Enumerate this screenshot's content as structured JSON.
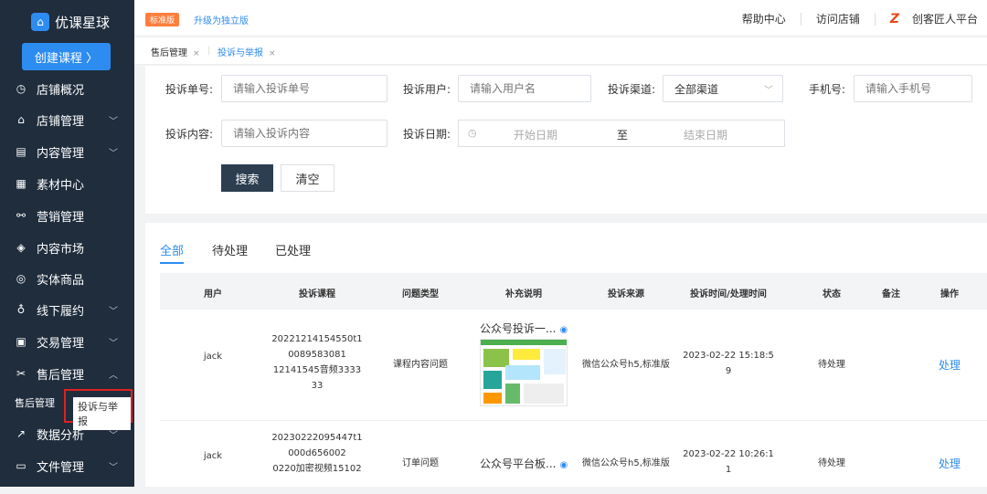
{
  "sidebar": {
    "logo_text": "优课星球",
    "create_button": "创建课程 〉",
    "items": [
      {
        "label": "店铺概况",
        "icon": "dashboard-icon",
        "glyph": "◷",
        "chevron": false
      },
      {
        "label": "店铺管理",
        "icon": "store-icon",
        "glyph": "⌂",
        "chevron": true
      },
      {
        "label": "内容管理",
        "icon": "content-icon",
        "glyph": "▤",
        "chevron": true
      },
      {
        "label": "素材中心",
        "icon": "material-icon",
        "glyph": "▦",
        "chevron": false
      },
      {
        "label": "营销管理",
        "icon": "marketing-icon",
        "glyph": "⚯",
        "chevron": false
      },
      {
        "label": "内容市场",
        "icon": "market-icon",
        "glyph": "◈",
        "chevron": false
      },
      {
        "label": "实体商品",
        "icon": "product-icon",
        "glyph": "◎",
        "chevron": false
      },
      {
        "label": "线下履约",
        "icon": "offline-icon",
        "glyph": "♁",
        "chevron": true
      },
      {
        "label": "交易管理",
        "icon": "trade-icon",
        "glyph": "▣",
        "chevron": true
      },
      {
        "label": "售后管理",
        "icon": "aftersale-icon",
        "glyph": "✂",
        "chevron": true,
        "expanded": true
      },
      {
        "label": "数据分析",
        "icon": "analytics-icon",
        "glyph": "↗",
        "chevron": true
      },
      {
        "label": "文件管理",
        "icon": "file-icon",
        "glyph": "▭",
        "chevron": true
      }
    ],
    "submenu": {
      "left_label": "售后管理",
      "active_label": "投诉与举报"
    }
  },
  "topbar": {
    "badge": "标准版",
    "upgrade": "升级为独立版",
    "help": "帮助中心",
    "visit_store": "访问店铺",
    "platform": "创客匠人平台",
    "brand_glyph": "Z"
  },
  "tabs": [
    {
      "label": "售后管理",
      "active": false
    },
    {
      "label": "投诉与举报",
      "active": true
    }
  ],
  "filters": {
    "complaint_no_label": "投诉单号:",
    "complaint_no_placeholder": "请输入投诉单号",
    "user_label": "投诉用户:",
    "user_placeholder": "请输入用户名",
    "channel_label": "投诉渠道:",
    "channel_value": "全部渠道",
    "phone_label": "手机号:",
    "phone_placeholder": "请输入手机号",
    "content_label": "投诉内容:",
    "content_placeholder": "请输入投诉内容",
    "date_label": "投诉日期:",
    "date_start": "开始日期",
    "date_to": "至",
    "date_end": "结束日期",
    "search_button": "搜索",
    "clear_button": "清空"
  },
  "status_tabs": [
    "全部",
    "待处理",
    "已处理"
  ],
  "table": {
    "columns": [
      "用户",
      "投诉课程",
      "问题类型",
      "补充说明",
      "投诉来源",
      "投诉时间/处理时间",
      "状态",
      "备注",
      "操作"
    ],
    "rows": [
      {
        "user": "jack",
        "course": [
          "20221214154550t1",
          "0089583081",
          "12141545音频3333",
          "33"
        ],
        "issue": "课程内容问题",
        "note_title": "公众号投诉一...",
        "source": "微信公众号h5,标准版",
        "time": [
          "2023-02-22 15:18:5",
          "9"
        ],
        "status": "待处理",
        "remark": "",
        "action": "处理"
      },
      {
        "user": "jack",
        "course": [
          "20230222095447t1",
          "000d656002",
          "0220加密视频15102"
        ],
        "issue": "订单问题",
        "note_title": "公众号平台板...",
        "source": "微信公众号h5,标准版",
        "time": [
          "2023-02-22 10:26:1",
          "1"
        ],
        "status": "待处理",
        "remark": "",
        "action": "处理"
      }
    ]
  },
  "colors": {
    "sidebar_bg": "#1f2d3d",
    "accent": "#2d8cf0",
    "badge": "#ff7e3d",
    "highlight_border": "#e02020"
  }
}
